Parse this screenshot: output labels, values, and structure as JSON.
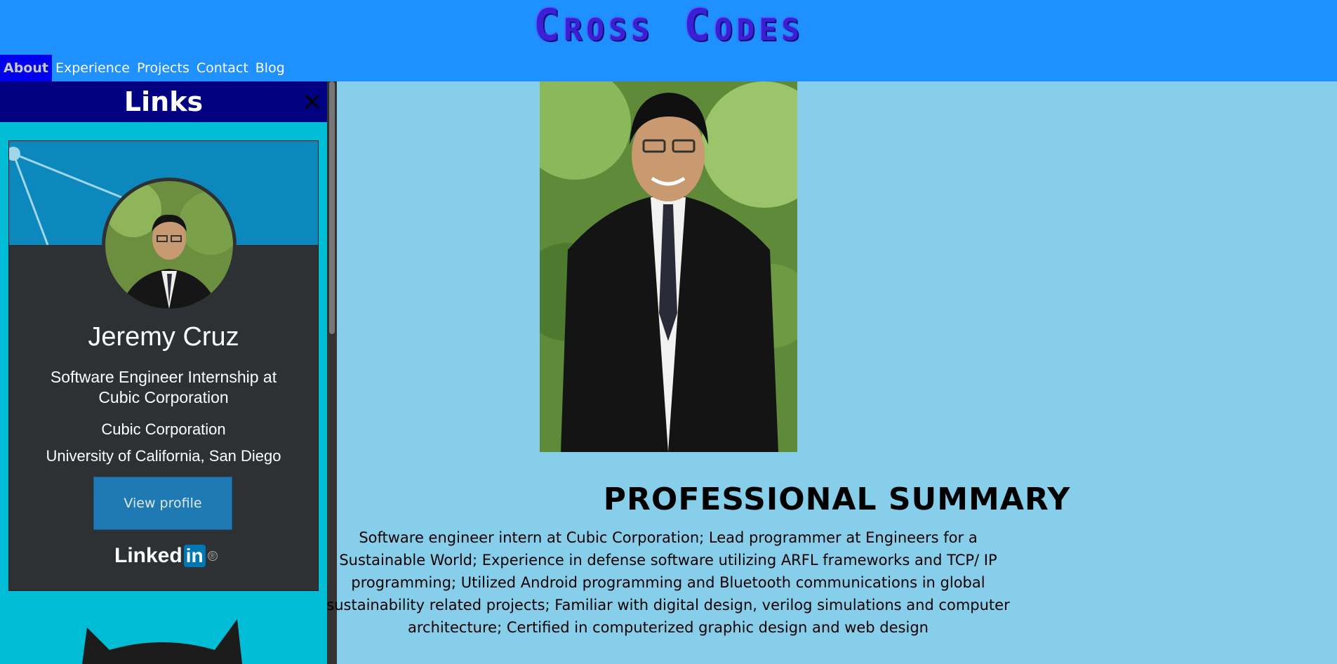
{
  "site": {
    "title": "Cross Codes"
  },
  "nav": {
    "items": [
      "About",
      "Experience",
      "Projects",
      "Contact",
      "Blog"
    ],
    "active": "About"
  },
  "sidebar": {
    "title": "Links",
    "linkedin": {
      "name": "Jeremy Cruz",
      "headline": "Software Engineer Internship at Cubic Corporation",
      "company": "Cubic Corporation",
      "school": "University of California, San Diego",
      "button": "View profile",
      "logo_text": "Linked",
      "logo_in": "in",
      "logo_reg": "®"
    }
  },
  "main": {
    "heading": "PROFESSIONAL SUMMARY",
    "summary": "Software engineer intern at Cubic Corporation; Lead programmer at Engineers for a Sustainable World; Experience in defense software utilizing ARFL frameworks and TCP/ IP programming; Utilized Android programming and Bluetooth communications in global sustainability related projects; Familiar with digital design, verilog simulations and computer architecture; Certified in computerized graphic design and web design"
  },
  "colors": {
    "header_bg": "#1e90ff",
    "page_bg": "#87ceeb",
    "sidebar_bg": "#00bcd4",
    "sidebar_header_bg": "#000080",
    "nav_active_bg": "#0000ee",
    "linkedin_card_bg": "#2e3133",
    "linkedin_blue": "#0077b5"
  },
  "icons": [
    "close-icon",
    "linkedin-logo",
    "github-icon"
  ]
}
